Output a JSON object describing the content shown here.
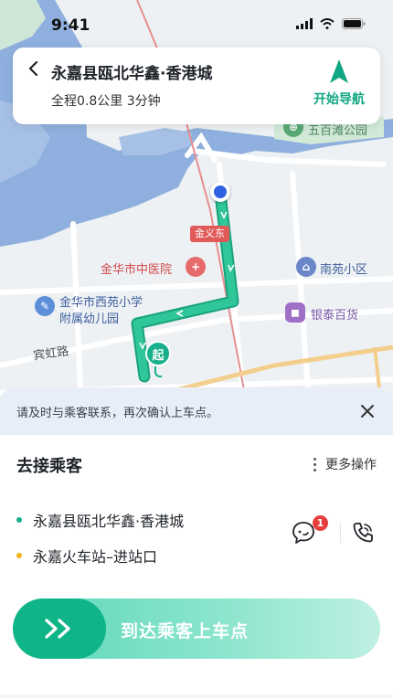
{
  "status_bar": {
    "time": "9:41"
  },
  "map": {
    "labels": {
      "park": "五百滩公园",
      "station": "金义东",
      "hospital": "金华市中医院",
      "community": "南苑小区",
      "school_line1": "金华市西苑小学",
      "school_line2": "附属幼儿园",
      "mall": "银泰百货",
      "road": "宾虹路"
    },
    "start_marker": "起",
    "route_color": "#21b98e"
  },
  "nav_card": {
    "destination": "永嘉县瓯北华鑫·香港城",
    "route_info": "全程0.8公里 3分钟",
    "start_navigation": "开始导航"
  },
  "notice": {
    "text": "请及时与乘客联系，再次确认上车点。"
  },
  "sheet": {
    "title": "去接乘客",
    "more_actions": "更多操作",
    "addresses": [
      {
        "text": "永嘉县瓯北华鑫·香港城",
        "dot_color": "#16b08a"
      },
      {
        "text": "永嘉火车站–进站口",
        "dot_color": "#f2b21b"
      }
    ],
    "unread_count": "1",
    "slide_action": "到达乘客上车点"
  },
  "colors": {
    "accent": "#10b489",
    "badge": "#e63d3d"
  }
}
